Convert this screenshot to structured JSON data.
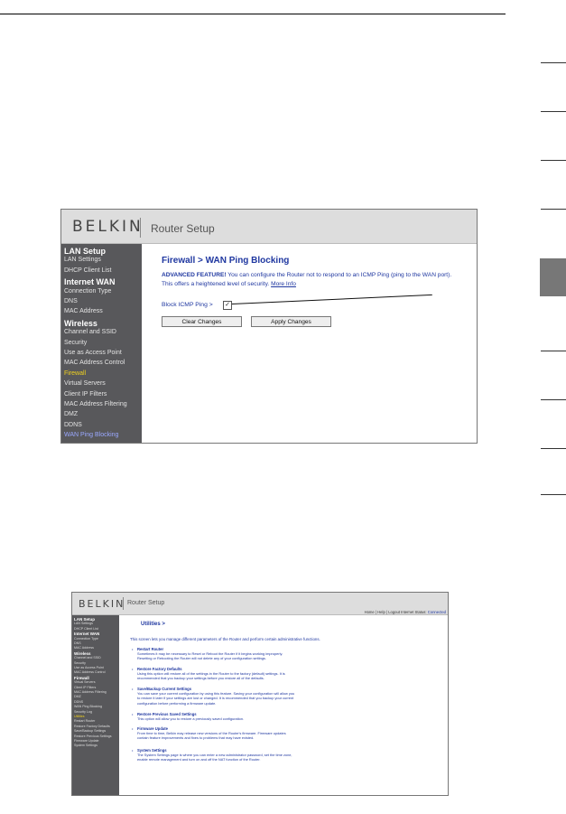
{
  "brand": "BELKIN",
  "app_title": "Router Setup",
  "firewall": {
    "sidebar": [
      {
        "label": "LAN Setup",
        "kind": "section"
      },
      {
        "label": "LAN Settings",
        "kind": "item"
      },
      {
        "label": "DHCP Client List",
        "kind": "item"
      },
      {
        "label": "Internet WAN",
        "kind": "section"
      },
      {
        "label": "Connection Type",
        "kind": "item"
      },
      {
        "label": "DNS",
        "kind": "item"
      },
      {
        "label": "MAC Address",
        "kind": "item"
      },
      {
        "label": "Wireless",
        "kind": "section"
      },
      {
        "label": "Channel and SSID",
        "kind": "item"
      },
      {
        "label": "Security",
        "kind": "item"
      },
      {
        "label": "Use as Access Point",
        "kind": "item"
      },
      {
        "label": "MAC Address Control",
        "kind": "item"
      },
      {
        "label": "Firewall",
        "kind": "current"
      },
      {
        "label": "Virtual Servers",
        "kind": "item"
      },
      {
        "label": "Client IP Filters",
        "kind": "item"
      },
      {
        "label": "MAC Address Filtering",
        "kind": "item"
      },
      {
        "label": "DMZ",
        "kind": "item"
      },
      {
        "label": "DDNS",
        "kind": "item"
      },
      {
        "label": "WAN Ping Blocking",
        "kind": "link"
      }
    ],
    "heading": "Firewall > WAN Ping Blocking",
    "advanced_label": "ADVANCED FEATURE!",
    "description_1": " You can configure the Router not to respond to an ICMP Ping (ping to the WAN port).",
    "description_2": "This offers a heightened level of security. ",
    "more_info": "More Info",
    "block_label": "Block ICMP Ping >",
    "block_checked": true,
    "check_glyph": "✓",
    "clear_label": "Clear Changes",
    "apply_label": "Apply Changes"
  },
  "utilities": {
    "toplinks": "Home | Help | Logout   Internet Status:",
    "status": "Connected",
    "sidebar": [
      {
        "label": "LAN Setup",
        "kind": "section"
      },
      {
        "label": "LAN Settings",
        "kind": "item"
      },
      {
        "label": "DHCP Client List",
        "kind": "item"
      },
      {
        "label": "Internet WAN",
        "kind": "section"
      },
      {
        "label": "Connection Type",
        "kind": "item"
      },
      {
        "label": "DNS",
        "kind": "item"
      },
      {
        "label": "MAC Address",
        "kind": "item"
      },
      {
        "label": "Wireless",
        "kind": "section"
      },
      {
        "label": "Channel and SSID",
        "kind": "item"
      },
      {
        "label": "Security",
        "kind": "item"
      },
      {
        "label": "Use as Access Point",
        "kind": "item"
      },
      {
        "label": "MAC Address Control",
        "kind": "item"
      },
      {
        "label": "Firewall",
        "kind": "section"
      },
      {
        "label": "Virtual Servers",
        "kind": "item"
      },
      {
        "label": "Client IP Filters",
        "kind": "item"
      },
      {
        "label": "MAC Address Filtering",
        "kind": "item"
      },
      {
        "label": "DMZ",
        "kind": "item"
      },
      {
        "label": "DDNS",
        "kind": "item"
      },
      {
        "label": "WAN Ping Blocking",
        "kind": "item"
      },
      {
        "label": "Security Log",
        "kind": "item"
      },
      {
        "label": "Utilities",
        "kind": "current"
      },
      {
        "label": "Restart Router",
        "kind": "item"
      },
      {
        "label": "Restore Factory Defaults",
        "kind": "item"
      },
      {
        "label": "Save/Backup Settings",
        "kind": "item"
      },
      {
        "label": "Restore Previous Settings",
        "kind": "item"
      },
      {
        "label": "Firmware Update",
        "kind": "item"
      },
      {
        "label": "System Settings",
        "kind": "item"
      }
    ],
    "heading": "Utilities >",
    "intro": "This screen lets you manage different parameters of the Router and perform certain administrative functions.",
    "items": [
      {
        "title": "Restart Router",
        "lines": [
          "Sometimes it may be necessary to Reset or Reboot the Router if it begins working improperly.",
          "Resetting or Rebooting the Router will not delete any of your configuration settings."
        ]
      },
      {
        "title": "Restore Factory Defaults",
        "lines": [
          "Using this option will restore all of the settings in the Router to the factory (default) settings. It is",
          "recommended that you backup your settings before you restore all of the defaults."
        ]
      },
      {
        "title": "Save/Backup Current Settings",
        "lines": [
          "You can save your current configuration by using this feature. Saving your configuration will allow you",
          "to restore it later if your settings are lost or changed. It is recommended that you backup your current",
          "configuration before performing a firmware update."
        ]
      },
      {
        "title": "Restore Previous Saved Settings",
        "lines": [
          "This option will allow you to restore a previously saved configuration."
        ]
      },
      {
        "title": "Firmware Update",
        "lines": [
          "From time to time, Belkin may release new versions of the Router's firmware. Firmware updates",
          "contain feature improvements and fixes to problems that may have existed."
        ]
      },
      {
        "title": "System Settings",
        "lines": [
          "The System Settings page is where you can enter a new administrator password, set the time zone,",
          "enable remote management and turn on and off the NAT function of the Router."
        ]
      }
    ]
  }
}
